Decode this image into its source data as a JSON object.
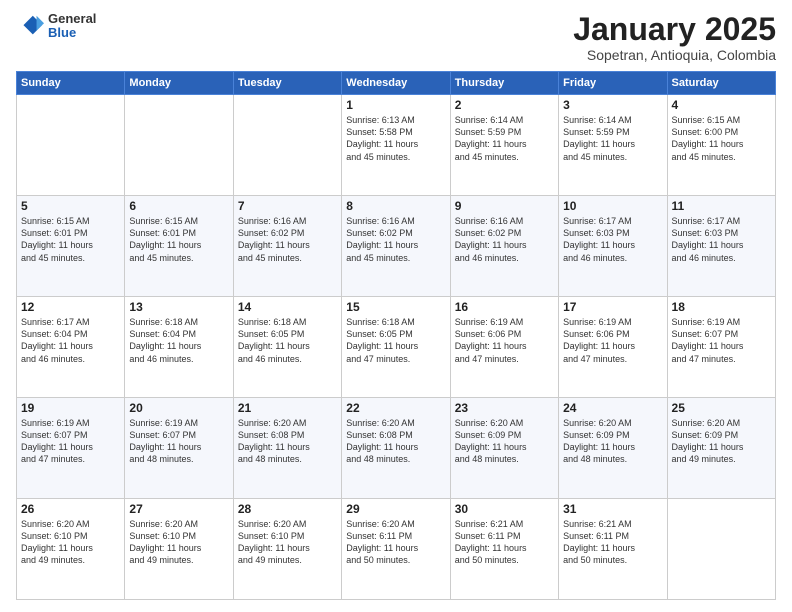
{
  "header": {
    "logo": {
      "general": "General",
      "blue": "Blue"
    },
    "title": "January 2025",
    "subtitle": "Sopetran, Antioquia, Colombia"
  },
  "weekdays": [
    "Sunday",
    "Monday",
    "Tuesday",
    "Wednesday",
    "Thursday",
    "Friday",
    "Saturday"
  ],
  "weeks": [
    [
      {
        "day": "",
        "info": ""
      },
      {
        "day": "",
        "info": ""
      },
      {
        "day": "",
        "info": ""
      },
      {
        "day": "1",
        "info": "Sunrise: 6:13 AM\nSunset: 5:58 PM\nDaylight: 11 hours\nand 45 minutes."
      },
      {
        "day": "2",
        "info": "Sunrise: 6:14 AM\nSunset: 5:59 PM\nDaylight: 11 hours\nand 45 minutes."
      },
      {
        "day": "3",
        "info": "Sunrise: 6:14 AM\nSunset: 5:59 PM\nDaylight: 11 hours\nand 45 minutes."
      },
      {
        "day": "4",
        "info": "Sunrise: 6:15 AM\nSunset: 6:00 PM\nDaylight: 11 hours\nand 45 minutes."
      }
    ],
    [
      {
        "day": "5",
        "info": "Sunrise: 6:15 AM\nSunset: 6:01 PM\nDaylight: 11 hours\nand 45 minutes."
      },
      {
        "day": "6",
        "info": "Sunrise: 6:15 AM\nSunset: 6:01 PM\nDaylight: 11 hours\nand 45 minutes."
      },
      {
        "day": "7",
        "info": "Sunrise: 6:16 AM\nSunset: 6:02 PM\nDaylight: 11 hours\nand 45 minutes."
      },
      {
        "day": "8",
        "info": "Sunrise: 6:16 AM\nSunset: 6:02 PM\nDaylight: 11 hours\nand 45 minutes."
      },
      {
        "day": "9",
        "info": "Sunrise: 6:16 AM\nSunset: 6:02 PM\nDaylight: 11 hours\nand 46 minutes."
      },
      {
        "day": "10",
        "info": "Sunrise: 6:17 AM\nSunset: 6:03 PM\nDaylight: 11 hours\nand 46 minutes."
      },
      {
        "day": "11",
        "info": "Sunrise: 6:17 AM\nSunset: 6:03 PM\nDaylight: 11 hours\nand 46 minutes."
      }
    ],
    [
      {
        "day": "12",
        "info": "Sunrise: 6:17 AM\nSunset: 6:04 PM\nDaylight: 11 hours\nand 46 minutes."
      },
      {
        "day": "13",
        "info": "Sunrise: 6:18 AM\nSunset: 6:04 PM\nDaylight: 11 hours\nand 46 minutes."
      },
      {
        "day": "14",
        "info": "Sunrise: 6:18 AM\nSunset: 6:05 PM\nDaylight: 11 hours\nand 46 minutes."
      },
      {
        "day": "15",
        "info": "Sunrise: 6:18 AM\nSunset: 6:05 PM\nDaylight: 11 hours\nand 47 minutes."
      },
      {
        "day": "16",
        "info": "Sunrise: 6:19 AM\nSunset: 6:06 PM\nDaylight: 11 hours\nand 47 minutes."
      },
      {
        "day": "17",
        "info": "Sunrise: 6:19 AM\nSunset: 6:06 PM\nDaylight: 11 hours\nand 47 minutes."
      },
      {
        "day": "18",
        "info": "Sunrise: 6:19 AM\nSunset: 6:07 PM\nDaylight: 11 hours\nand 47 minutes."
      }
    ],
    [
      {
        "day": "19",
        "info": "Sunrise: 6:19 AM\nSunset: 6:07 PM\nDaylight: 11 hours\nand 47 minutes."
      },
      {
        "day": "20",
        "info": "Sunrise: 6:19 AM\nSunset: 6:07 PM\nDaylight: 11 hours\nand 48 minutes."
      },
      {
        "day": "21",
        "info": "Sunrise: 6:20 AM\nSunset: 6:08 PM\nDaylight: 11 hours\nand 48 minutes."
      },
      {
        "day": "22",
        "info": "Sunrise: 6:20 AM\nSunset: 6:08 PM\nDaylight: 11 hours\nand 48 minutes."
      },
      {
        "day": "23",
        "info": "Sunrise: 6:20 AM\nSunset: 6:09 PM\nDaylight: 11 hours\nand 48 minutes."
      },
      {
        "day": "24",
        "info": "Sunrise: 6:20 AM\nSunset: 6:09 PM\nDaylight: 11 hours\nand 48 minutes."
      },
      {
        "day": "25",
        "info": "Sunrise: 6:20 AM\nSunset: 6:09 PM\nDaylight: 11 hours\nand 49 minutes."
      }
    ],
    [
      {
        "day": "26",
        "info": "Sunrise: 6:20 AM\nSunset: 6:10 PM\nDaylight: 11 hours\nand 49 minutes."
      },
      {
        "day": "27",
        "info": "Sunrise: 6:20 AM\nSunset: 6:10 PM\nDaylight: 11 hours\nand 49 minutes."
      },
      {
        "day": "28",
        "info": "Sunrise: 6:20 AM\nSunset: 6:10 PM\nDaylight: 11 hours\nand 49 minutes."
      },
      {
        "day": "29",
        "info": "Sunrise: 6:20 AM\nSunset: 6:11 PM\nDaylight: 11 hours\nand 50 minutes."
      },
      {
        "day": "30",
        "info": "Sunrise: 6:21 AM\nSunset: 6:11 PM\nDaylight: 11 hours\nand 50 minutes."
      },
      {
        "day": "31",
        "info": "Sunrise: 6:21 AM\nSunset: 6:11 PM\nDaylight: 11 hours\nand 50 minutes."
      },
      {
        "day": "",
        "info": ""
      }
    ]
  ]
}
